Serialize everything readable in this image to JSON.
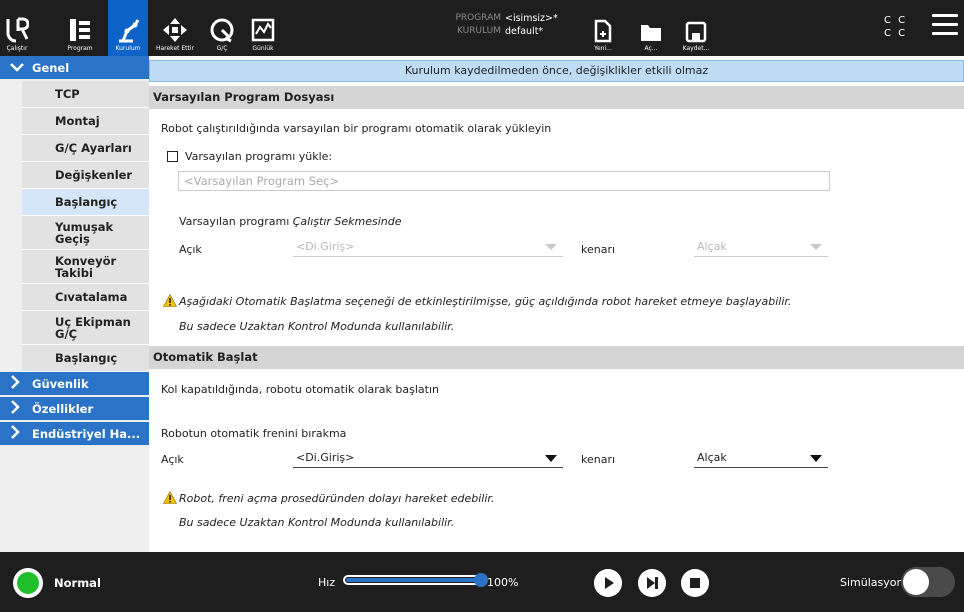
{
  "topbar": {
    "tabs": [
      {
        "label": "Çalıştır"
      },
      {
        "label": "Program"
      },
      {
        "label": "Kurulum"
      },
      {
        "label": "Hareket Ettir"
      },
      {
        "label": "G/Ç"
      },
      {
        "label": "Günlük"
      }
    ],
    "program_key": "PROGRAM",
    "program_value": "<isimsiz>*",
    "install_key": "KURULUM",
    "install_value": "default*",
    "file_buttons": [
      {
        "label": "Yeni..."
      },
      {
        "label": "Aç..."
      },
      {
        "label": "Kaydet..."
      }
    ],
    "cc_row1": "C C",
    "cc_row2": "C C"
  },
  "sidebar": {
    "genel": "Genel",
    "items": [
      "TCP",
      "Montaj",
      "G/Ç Ayarları",
      "Değişkenler",
      "Başlangıç",
      "Yumuşak Geçiş",
      "Konveyör Takibi",
      "Cıvatalama",
      "Uç Ekipman G/Ç",
      "Başlangıç"
    ],
    "selected_index": 4,
    "categories": [
      "Güvenlik",
      "Özellikler",
      "Endüstriyel Ha..."
    ]
  },
  "content": {
    "banner": "Kurulum kaydedilmeden önce, değişiklikler etkili olmaz",
    "section1": {
      "title": "Varsayılan Program Dosyası",
      "desc": "Robot çalıştırıldığında varsayılan bir programı otomatik olarak yükleyin",
      "checkbox_label": "Varsayılan programı yükle:",
      "checkbox_checked": false,
      "program_placeholder": "<Varsayılan Program Seç>",
      "run_tab_prefix": "Varsayılan programı ",
      "run_tab_italic": "Çalıştır Sekmesinde",
      "open_label": "Açık",
      "input_select": "<Di.Giriş>",
      "edge_label": "kenarı",
      "edge_select": "Alçak",
      "warning": "Aşağıdaki Otomatik Başlatma seçeneği de etkinleştirilmişse, güç açıldığında robot hareket etmeye başlayabilir.",
      "remote_note": "Bu sadece Uzaktan Kontrol Modunda kullanılabilir."
    },
    "section2": {
      "title": "Otomatik Başlat",
      "desc": "Kol kapatıldığında, robotu otomatik olarak başlatın",
      "brake_label": "Robotun otomatik frenini bırakma",
      "open_label": "Açık",
      "input_select": "<Di.Giriş>",
      "edge_label": "kenarı",
      "edge_select": "Alçak",
      "warning": "Robot, freni açma prosedüründen dolayı hareket edebilir.",
      "remote_note": "Bu sadece Uzaktan Kontrol Modunda kullanılabilir."
    }
  },
  "footer": {
    "status": "Normal",
    "speed_label": "Hız",
    "speed_value": "100%",
    "speed_fraction": 1.0,
    "simulation_label": "Simülasyon"
  },
  "colors": {
    "accent": "#2a73c6",
    "topbar": "#1e1e1e",
    "status_ok": "#1fbf2a",
    "warning": "#f2c200"
  }
}
